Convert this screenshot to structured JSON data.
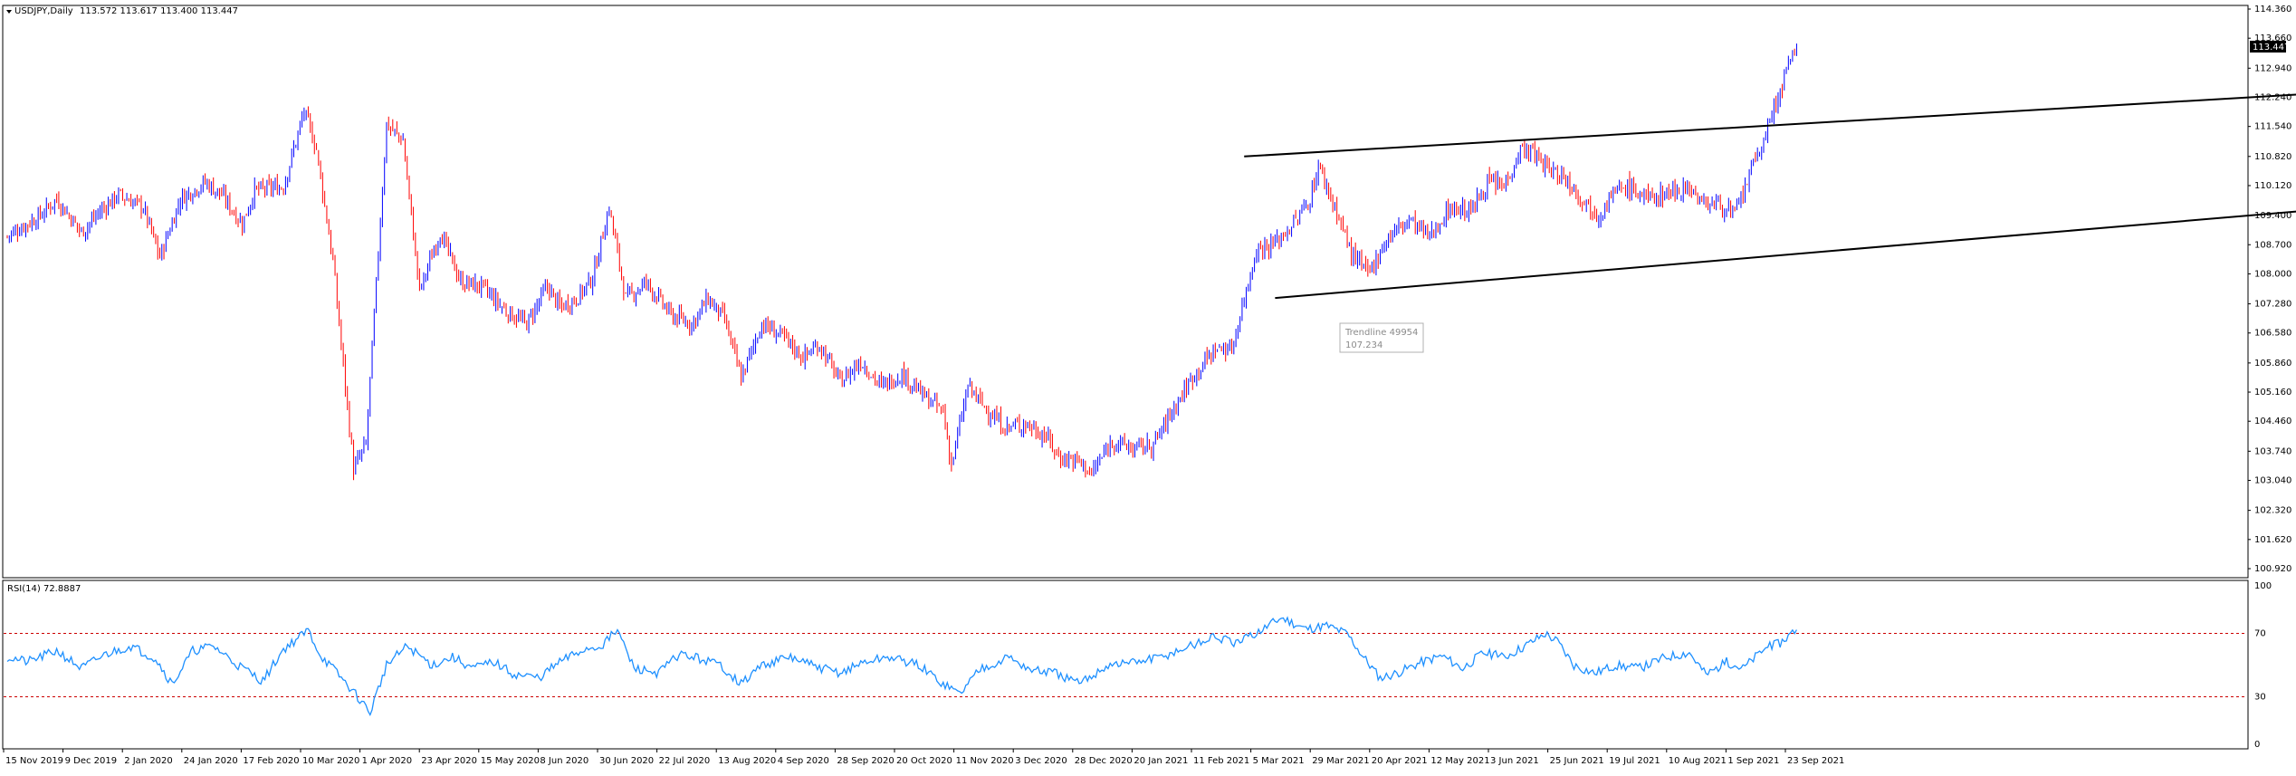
{
  "header": {
    "symbol": "USDJPY,Daily",
    "ohlc": "113.572 113.617 113.400 113.447"
  },
  "rsi_header": {
    "label": "RSI(14) 72.8887"
  },
  "tooltip": {
    "line1": "Trendline 49954",
    "line2": "107.234"
  },
  "colors": {
    "bull": "#0000ff",
    "bear": "#ff0000",
    "rsi": "#1e90ff",
    "level": "#cc0000",
    "trend": "#000000"
  },
  "chart_data": [
    {
      "type": "candlestick",
      "title": "USDJPY,Daily",
      "ylim": [
        100.92,
        114.36
      ],
      "y_ticks": [
        "114.360",
        "113.660",
        "112.940",
        "112.240",
        "111.540",
        "110.820",
        "110.120",
        "109.400",
        "108.700",
        "108.000",
        "107.280",
        "106.580",
        "105.860",
        "105.160",
        "104.460",
        "103.740",
        "103.040",
        "102.320",
        "101.620",
        "100.920"
      ],
      "current_price": "113.447",
      "x_labels": [
        "15 Nov 2019",
        "9 Dec 2019",
        "2 Jan 2020",
        "24 Jan 2020",
        "17 Feb 2020",
        "10 Mar 2020",
        "1 Apr 2020",
        "23 Apr 2020",
        "15 May 2020",
        "8 Jun 2020",
        "30 Jun 2020",
        "22 Jul 2020",
        "13 Aug 2020",
        "4 Sep 2020",
        "28 Sep 2020",
        "20 Oct 2020",
        "11 Nov 2020",
        "3 Dec 2020",
        "28 Dec 2020",
        "20 Jan 2021",
        "11 Feb 2021",
        "5 Mar 2021",
        "29 Mar 2021",
        "20 Apr 2021",
        "12 May 2021",
        "3 Jun 2021",
        "25 Jun 2021",
        "19 Jul 2021",
        "10 Aug 2021",
        "1 Sep 2021",
        "23 Sep 2021"
      ],
      "close_path": [
        [
          0,
          108.9
        ],
        [
          16,
          109.4
        ],
        [
          24,
          109.8
        ],
        [
          36,
          109.0
        ],
        [
          45,
          109.5
        ],
        [
          54,
          109.9
        ],
        [
          66,
          109.6
        ],
        [
          74,
          108.4
        ],
        [
          84,
          109.8
        ],
        [
          96,
          110.2
        ],
        [
          104,
          109.9
        ],
        [
          114,
          109.2
        ],
        [
          120,
          110.0
        ],
        [
          134,
          110.1
        ],
        [
          144,
          111.9
        ],
        [
          150,
          111.0
        ],
        [
          158,
          108.3
        ],
        [
          168,
          103.3
        ],
        [
          174,
          103.9
        ],
        [
          184,
          111.6
        ],
        [
          192,
          111.2
        ],
        [
          200,
          107.6
        ],
        [
          210,
          109.0
        ],
        [
          220,
          107.8
        ],
        [
          230,
          107.7
        ],
        [
          242,
          107.1
        ],
        [
          252,
          106.8
        ],
        [
          262,
          107.7
        ],
        [
          268,
          107.2
        ],
        [
          276,
          107.4
        ],
        [
          284,
          107.9
        ],
        [
          292,
          109.6
        ],
        [
          300,
          107.4
        ],
        [
          310,
          107.8
        ],
        [
          322,
          107.0
        ],
        [
          332,
          106.8
        ],
        [
          340,
          107.4
        ],
        [
          348,
          106.9
        ],
        [
          356,
          105.5
        ],
        [
          366,
          106.8
        ],
        [
          376,
          106.5
        ],
        [
          386,
          106.0
        ],
        [
          394,
          106.3
        ],
        [
          404,
          105.4
        ],
        [
          414,
          105.9
        ],
        [
          424,
          105.3
        ],
        [
          434,
          105.6
        ],
        [
          446,
          105.0
        ],
        [
          454,
          104.7
        ],
        [
          458,
          103.4
        ],
        [
          466,
          105.3
        ],
        [
          474,
          104.8
        ],
        [
          484,
          104.3
        ],
        [
          494,
          104.4
        ],
        [
          504,
          104.1
        ],
        [
          510,
          103.6
        ],
        [
          520,
          103.5
        ],
        [
          526,
          103.2
        ],
        [
          536,
          104.0
        ],
        [
          546,
          103.8
        ],
        [
          556,
          103.9
        ],
        [
          566,
          104.8
        ],
        [
          576,
          105.6
        ],
        [
          586,
          106.2
        ],
        [
          594,
          106.2
        ],
        [
          606,
          108.6
        ],
        [
          614,
          108.7
        ],
        [
          624,
          109.2
        ],
        [
          632,
          109.8
        ],
        [
          636,
          110.6
        ],
        [
          644,
          109.6
        ],
        [
          652,
          108.5
        ],
        [
          660,
          108.0
        ],
        [
          670,
          108.9
        ],
        [
          680,
          109.3
        ],
        [
          690,
          108.9
        ],
        [
          700,
          109.6
        ],
        [
          710,
          109.5
        ],
        [
          718,
          110.2
        ],
        [
          726,
          110.1
        ],
        [
          734,
          111.0
        ],
        [
          740,
          110.9
        ],
        [
          748,
          110.5
        ],
        [
          756,
          110.3
        ],
        [
          764,
          109.8
        ],
        [
          772,
          109.4
        ],
        [
          778,
          109.9
        ],
        [
          786,
          110.1
        ],
        [
          796,
          109.8
        ],
        [
          808,
          110.0
        ],
        [
          816,
          110.1
        ],
        [
          822,
          109.7
        ],
        [
          830,
          109.7
        ],
        [
          838,
          109.4
        ],
        [
          846,
          110.5
        ],
        [
          852,
          111.2
        ],
        [
          856,
          111.8
        ],
        [
          862,
          112.7
        ],
        [
          868,
          113.45
        ]
      ],
      "trendlines": [
        {
          "from": [
            600,
            110.82
          ],
          "to": [
            1270,
            112.77
          ]
        },
        {
          "from": [
            615,
            107.42
          ],
          "to": [
            1290,
            110.25
          ]
        }
      ]
    },
    {
      "type": "line",
      "title": "RSI(14) 72.8887",
      "ylim": [
        0,
        100
      ],
      "y_ticks": [
        "100",
        "70",
        "30",
        "0"
      ],
      "levels": [
        70,
        30
      ],
      "values_path": [
        [
          0,
          55
        ],
        [
          10,
          52
        ],
        [
          24,
          59
        ],
        [
          36,
          48
        ],
        [
          48,
          57
        ],
        [
          60,
          62
        ],
        [
          72,
          54
        ],
        [
          80,
          38
        ],
        [
          90,
          59
        ],
        [
          100,
          62
        ],
        [
          112,
          50
        ],
        [
          124,
          40
        ],
        [
          134,
          60
        ],
        [
          146,
          72
        ],
        [
          152,
          56
        ],
        [
          160,
          45
        ],
        [
          170,
          30
        ],
        [
          176,
          20
        ],
        [
          184,
          50
        ],
        [
          194,
          62
        ],
        [
          206,
          50
        ],
        [
          216,
          55
        ],
        [
          226,
          48
        ],
        [
          236,
          52
        ],
        [
          246,
          44
        ],
        [
          258,
          42
        ],
        [
          268,
          52
        ],
        [
          280,
          60
        ],
        [
          288,
          62
        ],
        [
          296,
          72
        ],
        [
          304,
          48
        ],
        [
          316,
          45
        ],
        [
          326,
          57
        ],
        [
          336,
          54
        ],
        [
          346,
          50
        ],
        [
          356,
          38
        ],
        [
          366,
          50
        ],
        [
          380,
          55
        ],
        [
          392,
          49
        ],
        [
          404,
          45
        ],
        [
          416,
          52
        ],
        [
          428,
          55
        ],
        [
          442,
          50
        ],
        [
          452,
          40
        ],
        [
          462,
          32
        ],
        [
          472,
          48
        ],
        [
          486,
          55
        ],
        [
          496,
          47
        ],
        [
          508,
          45
        ],
        [
          520,
          38
        ],
        [
          534,
          50
        ],
        [
          548,
          52
        ],
        [
          560,
          55
        ],
        [
          574,
          62
        ],
        [
          586,
          68
        ],
        [
          596,
          63
        ],
        [
          608,
          72
        ],
        [
          618,
          80
        ],
        [
          630,
          73
        ],
        [
          640,
          75
        ],
        [
          650,
          70
        ],
        [
          658,
          55
        ],
        [
          666,
          42
        ],
        [
          674,
          45
        ],
        [
          686,
          52
        ],
        [
          696,
          56
        ],
        [
          706,
          48
        ],
        [
          716,
          58
        ],
        [
          726,
          55
        ],
        [
          736,
          62
        ],
        [
          746,
          70
        ],
        [
          752,
          65
        ],
        [
          760,
          50
        ],
        [
          770,
          45
        ],
        [
          780,
          50
        ],
        [
          792,
          48
        ],
        [
          804,
          55
        ],
        [
          816,
          58
        ],
        [
          824,
          44
        ],
        [
          834,
          52
        ],
        [
          842,
          48
        ],
        [
          852,
          60
        ],
        [
          860,
          64
        ],
        [
          868,
          73
        ]
      ]
    }
  ]
}
